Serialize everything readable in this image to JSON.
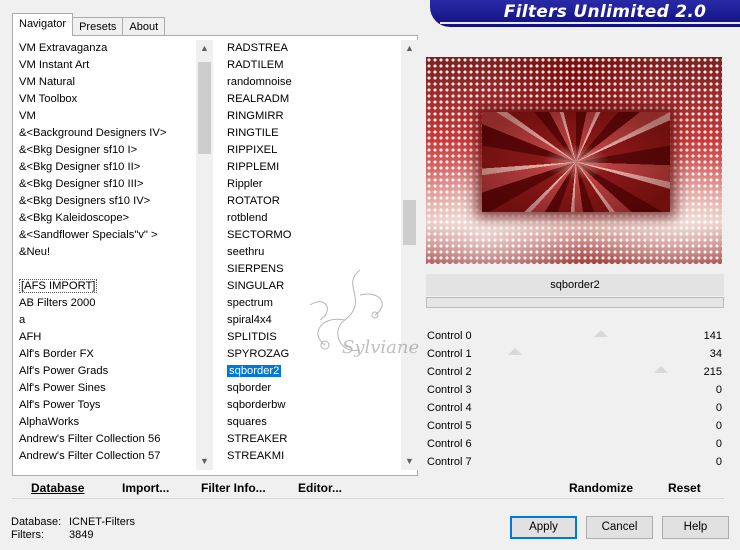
{
  "tabs": [
    "Navigator",
    "Presets",
    "About"
  ],
  "banner_title": "Filters Unlimited 2.0",
  "categories": [
    "VM Extravaganza",
    "VM Instant Art",
    "VM Natural",
    "VM Toolbox",
    "VM",
    "&<Background Designers IV>",
    "&<Bkg Designer sf10 I>",
    "&<Bkg Designer sf10 II>",
    "&<Bkg Designer sf10 III>",
    "&<Bkg Designers sf10 IV>",
    "&<Bkg Kaleidoscope>",
    "&<Sandflower Specials\"v\" >",
    "&Neu!",
    "",
    "[AFS IMPORT]",
    "AB Filters 2000",
    "a",
    "AFH",
    "Alf's Border FX",
    "Alf's Power Grads",
    "Alf's Power Sines",
    "Alf's Power Toys",
    "AlphaWorks",
    "Andrew's Filter Collection 56",
    "Andrew's Filter Collection 57"
  ],
  "filters": [
    "RADSTREA",
    "RADTILEM",
    "randomnoise",
    "REALRADM",
    "RINGMIRR",
    "RINGTILE",
    "RIPPIXEL",
    "RIPPLEMI",
    "Rippler",
    "ROTATOR",
    "rotblend",
    "SECTORMO",
    "seethru",
    "SIERPENS",
    "SINGULAR",
    "spectrum",
    "spiral4x4",
    "SPLITDIS",
    "SPYROZAG",
    "sqborder2",
    "sqborder",
    "sqborderbw",
    "squares",
    "STREAKER",
    "STREAKMI"
  ],
  "selected_filter": "sqborder2",
  "progress_value": 0,
  "controls": [
    {
      "label": "Control 0",
      "value": "141",
      "level": 0.553
    },
    {
      "label": "Control 1",
      "value": "34",
      "level": 0.133
    },
    {
      "label": "Control 2",
      "value": "215",
      "level": 0.843
    },
    {
      "label": "Control 3",
      "value": "0",
      "level": 0
    },
    {
      "label": "Control 4",
      "value": "0",
      "level": 0
    },
    {
      "label": "Control 5",
      "value": "0",
      "level": 0
    },
    {
      "label": "Control 6",
      "value": "0",
      "level": 0
    },
    {
      "label": "Control 7",
      "value": "0",
      "level": 0
    }
  ],
  "bottom_links": {
    "database": "Database",
    "import": "Import...",
    "filter_info": "Filter Info...",
    "editor": "Editor...",
    "randomize": "Randomize",
    "reset": "Reset"
  },
  "info": {
    "database_label": "Database:",
    "database_value": "ICNET-Filters",
    "filters_label": "Filters:",
    "filters_value": "3849"
  },
  "buttons": {
    "apply": "Apply",
    "cancel": "Cancel",
    "help": "Help"
  },
  "watermark_text": "Sylviane",
  "colors": {
    "selection": "#0078d7",
    "banner": "#16168f"
  }
}
